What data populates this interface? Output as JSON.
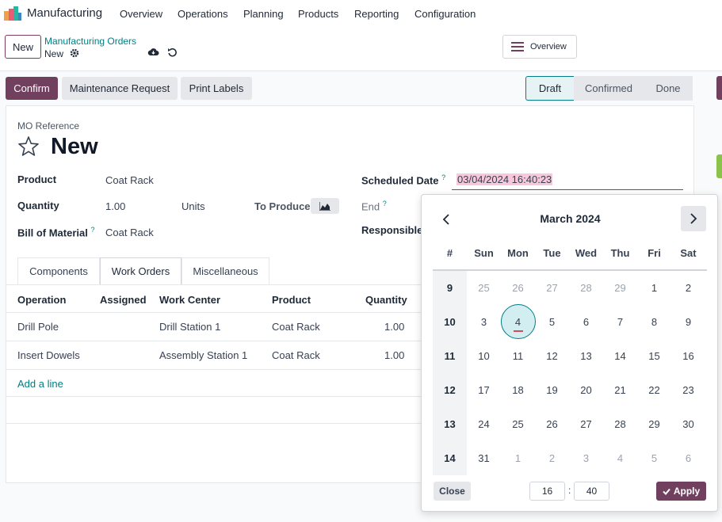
{
  "app": {
    "name": "Manufacturing"
  },
  "menu": [
    "Overview",
    "Operations",
    "Planning",
    "Products",
    "Reporting",
    "Configuration"
  ],
  "controlbar": {
    "new_label": "New",
    "breadcrumb_parent": "Manufacturing Orders",
    "breadcrumb_current": "New",
    "overview_label": "Overview"
  },
  "actions": {
    "confirm": "Confirm",
    "maintenance": "Maintenance Request",
    "print_labels": "Print Labels"
  },
  "status": {
    "steps": [
      "Draft",
      "Confirmed",
      "Done"
    ],
    "active": "Draft"
  },
  "form": {
    "mo_reference_label": "MO Reference",
    "title": "New",
    "product_label": "Product",
    "product_value": "Coat Rack",
    "quantity_label": "Quantity",
    "quantity_value": "1.00",
    "quantity_unit": "Units",
    "to_produce_label": "To Produce",
    "bom_label": "Bill of Material",
    "bom_value": "Coat Rack",
    "scheduled_date_label": "Scheduled Date",
    "scheduled_date_value": "03/04/2024 16:40:23",
    "end_label": "End",
    "responsible_label": "Responsible",
    "help_mark": "?"
  },
  "tabs": [
    "Components",
    "Work Orders",
    "Miscellaneous"
  ],
  "active_tab": "Work Orders",
  "table": {
    "headers": [
      "Operation",
      "Assigned",
      "Work Center",
      "Product",
      "Quantity"
    ],
    "rows": [
      {
        "operation": "Drill Pole",
        "assigned": "",
        "work_center": "Drill Station 1",
        "product": "Coat Rack",
        "quantity": "1.00"
      },
      {
        "operation": "Insert Dowels",
        "assigned": "",
        "work_center": "Assembly Station 1",
        "product": "Coat Rack",
        "quantity": "1.00"
      }
    ],
    "add_line": "Add a line"
  },
  "datepicker": {
    "month": "March 2024",
    "week_header": "#",
    "weekdays": [
      "Sun",
      "Mon",
      "Tue",
      "Wed",
      "Thu",
      "Fri",
      "Sat"
    ],
    "weeks": [
      {
        "num": "9",
        "days": [
          {
            "d": "25",
            "m": true
          },
          {
            "d": "26",
            "m": true
          },
          {
            "d": "27",
            "m": true
          },
          {
            "d": "28",
            "m": true
          },
          {
            "d": "29",
            "m": true
          },
          {
            "d": "1",
            "m": false
          },
          {
            "d": "2",
            "m": false
          }
        ]
      },
      {
        "num": "10",
        "days": [
          {
            "d": "3",
            "m": false
          },
          {
            "d": "4",
            "m": false
          },
          {
            "d": "5",
            "m": false
          },
          {
            "d": "6",
            "m": false
          },
          {
            "d": "7",
            "m": false
          },
          {
            "d": "8",
            "m": false
          },
          {
            "d": "9",
            "m": false
          }
        ]
      },
      {
        "num": "11",
        "days": [
          {
            "d": "10",
            "m": false
          },
          {
            "d": "11",
            "m": false
          },
          {
            "d": "12",
            "m": false
          },
          {
            "d": "13",
            "m": false
          },
          {
            "d": "14",
            "m": false
          },
          {
            "d": "15",
            "m": false
          },
          {
            "d": "16",
            "m": false
          }
        ]
      },
      {
        "num": "12",
        "days": [
          {
            "d": "17",
            "m": false
          },
          {
            "d": "18",
            "m": false
          },
          {
            "d": "19",
            "m": false
          },
          {
            "d": "20",
            "m": false
          },
          {
            "d": "21",
            "m": false
          },
          {
            "d": "22",
            "m": false
          },
          {
            "d": "23",
            "m": false
          }
        ]
      },
      {
        "num": "13",
        "days": [
          {
            "d": "24",
            "m": false
          },
          {
            "d": "25",
            "m": false
          },
          {
            "d": "26",
            "m": false
          },
          {
            "d": "27",
            "m": false
          },
          {
            "d": "28",
            "m": false
          },
          {
            "d": "29",
            "m": false
          },
          {
            "d": "30",
            "m": false
          }
        ]
      },
      {
        "num": "14",
        "days": [
          {
            "d": "31",
            "m": false
          },
          {
            "d": "1",
            "m": true
          },
          {
            "d": "2",
            "m": true
          },
          {
            "d": "3",
            "m": true
          },
          {
            "d": "4",
            "m": true
          },
          {
            "d": "5",
            "m": true
          },
          {
            "d": "6",
            "m": true
          }
        ]
      }
    ],
    "selected_day": "4",
    "hour": "16",
    "minute": "40",
    "time_separator": ":",
    "close_label": "Close",
    "apply_label": "Apply"
  },
  "colors": {
    "primary": "#71405f",
    "accent": "#017e84",
    "highlight": "#f8c7d9"
  }
}
